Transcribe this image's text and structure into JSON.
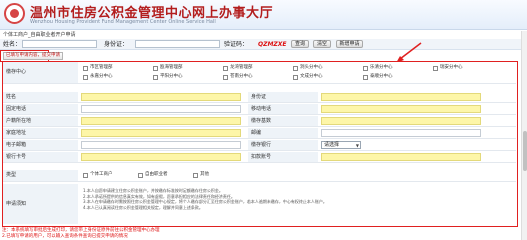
{
  "header": {
    "title": "温州市住房公积金管理中心网上办事大厅",
    "subtitle": "Wenzhou Housing Provident Fund Management Center Online Service Hall"
  },
  "breadcrumb": "个体工商户_自由职业者开户申请",
  "login": {
    "name_label": "姓名：",
    "id_label": "身份证：",
    "captcha_label": "验证码：",
    "captcha_value": "QZMZXE",
    "query_btn": "查询",
    "clear_btn": "清空",
    "new_btn": "新增申请"
  },
  "left_button": "已填写申请内容，提交申请",
  "form": {
    "center_label": "缴存中心",
    "centers_row1": [
      "市区管理部",
      "瓯海管理部",
      "龙湾管理部",
      "洞头分中心",
      "乐清分中心",
      "瑞安分中心"
    ],
    "centers_row2": [
      "永嘉分中心",
      "平阳分中心",
      "苍南分中心",
      "文成分中心",
      "泰顺分中心"
    ],
    "name_label": "姓名",
    "id_label": "身份证",
    "home_phone_label": "固定电话",
    "mobile_label": "移动电话",
    "hukou_label": "户籍所在地",
    "deposit_base_label": "缴存基数",
    "address_label": "家庭地址",
    "postcode_label": "邮编",
    "email_label": "电子邮箱",
    "bank_label": "缴存银行",
    "bank_select": "请选择",
    "account_label": "银行卡号",
    "pay_label": "扣款账号",
    "type_label": "类型",
    "types": [
      "个体工商户",
      "自由职业者",
      "其他"
    ],
    "terms_label": "申请须知",
    "terms": [
      "1.本人自愿申请建立住房公积金账户，并按缴存标准按时足额缴存住房公积金。",
      "2.本人承诺所提供的信息真实有效，如有虚假，愿意承担相应的法律责任和经济责任。",
      "3.本人在申请缴存时需按照住房公积金管理中心规定，将个人缴存部分汇至住房公积金账户，若本人逾期未缴存，中心有权终止本人账户。",
      "4.本人已认真阅读住房公积金管理相关规定，理解并同意上述条款。"
    ]
  },
  "footnotes": [
    "注：本系统填写审批后生成打印，请您带上身份证原件前往公积金管理中心办理",
    "2.已填写申请的用户，可以输入查询条件查询已提交申请的情况"
  ]
}
